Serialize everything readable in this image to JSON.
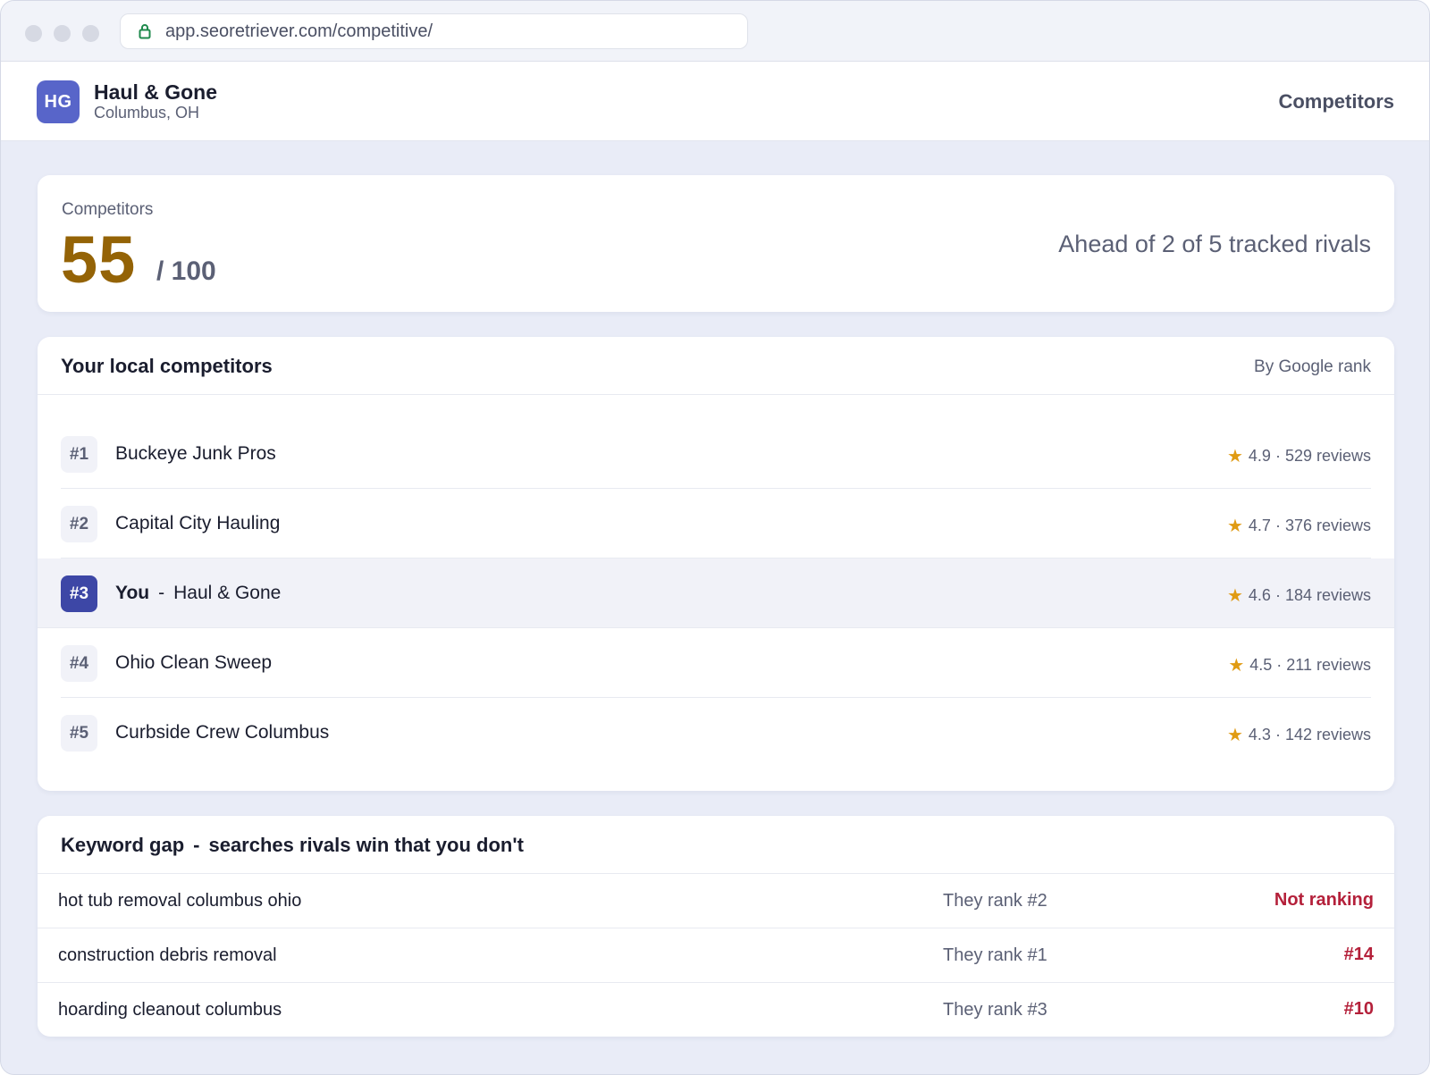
{
  "browser": {
    "url": "app.seoretriever.com/competitive/"
  },
  "header": {
    "logo_initials": "HG",
    "business_name": "Haul & Gone",
    "location": "Columbus, OH",
    "nav_label": "Competitors"
  },
  "score": {
    "label": "Competitors",
    "value": "55",
    "max": "/ 100",
    "summary": "Ahead of 2 of 5 tracked rivals",
    "value_color": "#946306"
  },
  "competitors": {
    "title": "Your local competitors",
    "sort_label": "By Google rank",
    "rows": [
      {
        "rank": "#1",
        "name": "Buckeye Junk Pros",
        "rating": "4.9 · 529 reviews"
      },
      {
        "rank": "#2",
        "name": "Capital City Hauling",
        "rating": "4.7 · 376 reviews"
      },
      {
        "rank": "#3",
        "you_label": "You",
        "name": "Haul & Gone",
        "rating": "4.6 · 184 reviews"
      },
      {
        "rank": "#4",
        "name": "Ohio Clean Sweep",
        "rating": "4.5 · 211 reviews"
      },
      {
        "rank": "#5",
        "name": "Curbside Crew Columbus",
        "rating": "4.3 · 142 reviews"
      }
    ]
  },
  "keyword_gap": {
    "title": "Keyword gap",
    "subtitle": "searches rivals win that you don't",
    "rows": [
      {
        "term": "hot tub removal columbus ohio",
        "their_rank": "They rank #2",
        "your_rank": "Not ranking"
      },
      {
        "term": "construction debris removal",
        "their_rank": "They rank #1",
        "your_rank": "#14"
      },
      {
        "term": "hoarding cleanout columbus",
        "their_rank": "They rank #3",
        "your_rank": "#10"
      }
    ]
  },
  "icons": {
    "lock": "lock-icon",
    "star": "star-icon"
  },
  "colors": {
    "accent": "#5865c9",
    "you_badge": "#3d47a6",
    "star": "#e09b13",
    "negative": "#b4203a"
  }
}
